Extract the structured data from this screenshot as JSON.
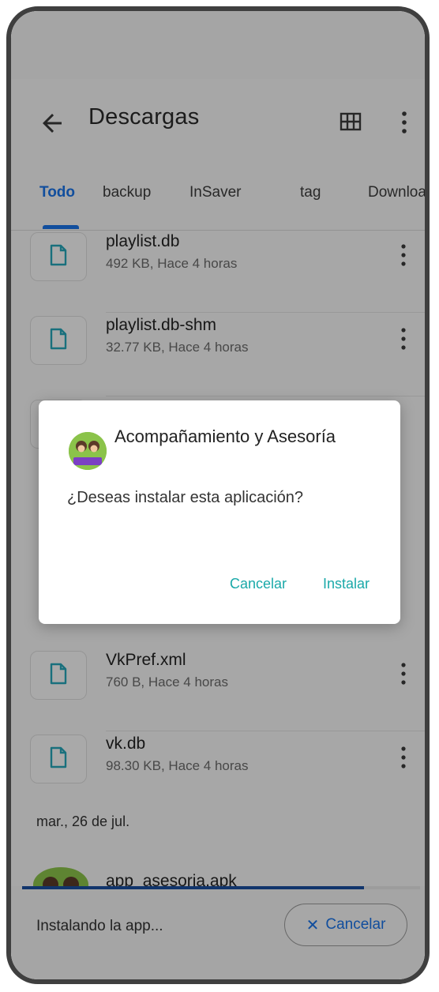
{
  "header": {
    "title": "Descargas"
  },
  "tabs": [
    {
      "label": "Todo",
      "active": true
    },
    {
      "label": "backup"
    },
    {
      "label": "InSaver"
    },
    {
      "label": "tag"
    },
    {
      "label": "Downloa"
    }
  ],
  "files": [
    {
      "name": "playlist.db",
      "meta": "492 KB, Hace 4 horas"
    },
    {
      "name": "playlist.db-shm",
      "meta": "32.77 KB, Hace 4 horas"
    },
    {
      "name": "VkPref.xml",
      "meta": "760 B, Hace 4 horas"
    },
    {
      "name": "vk.db",
      "meta": "98.30 KB, Hace 4 horas"
    }
  ],
  "date_group": "mar., 26 de jul.",
  "apk": {
    "name": "app_asesoria.apk"
  },
  "bottom_bar": {
    "status": "Instalando la app...",
    "cancel_label": "Cancelar",
    "progress": 0.86
  },
  "dialog": {
    "app_title": "Acompañamiento y Asesoría",
    "question": "¿Deseas instalar esta aplicación?",
    "cancel_label": "Cancelar",
    "install_label": "Instalar"
  },
  "colors": {
    "accent": "#1a73e8",
    "dialog_button": "#1aa9a9",
    "progress": "#1a4fa0"
  }
}
